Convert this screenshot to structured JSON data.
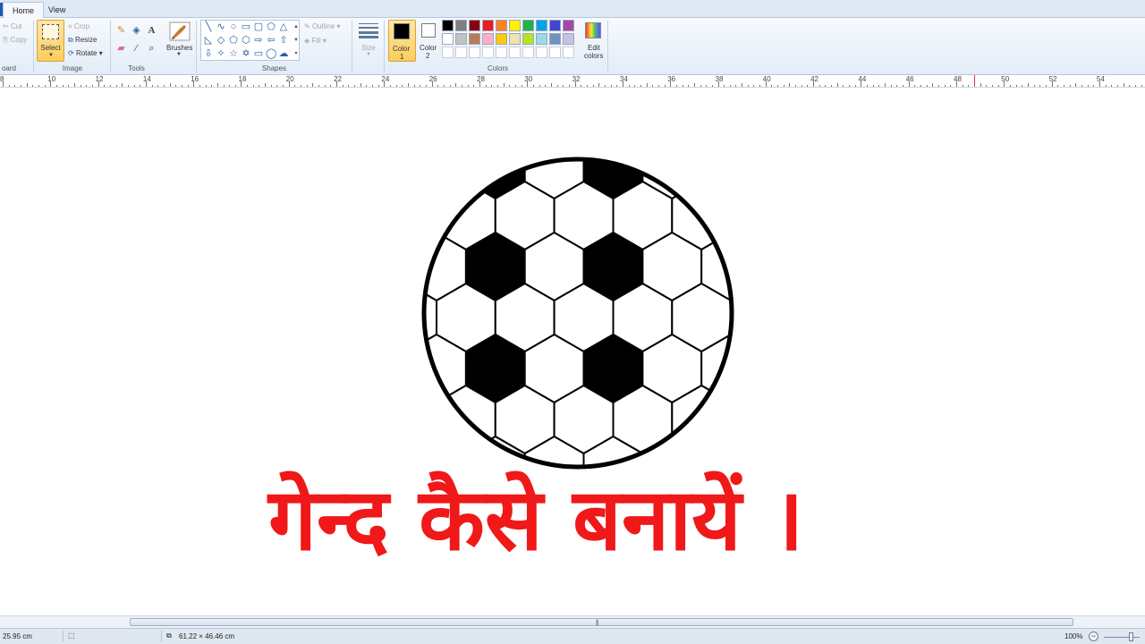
{
  "tabs": {
    "home": "Home",
    "view": "View"
  },
  "clipboard": {
    "cut": "Cut",
    "copy": "Copy",
    "group": "oard"
  },
  "image": {
    "select": "Select",
    "crop": "Crop",
    "resize": "Resize",
    "rotate": "Rotate",
    "group": "Image"
  },
  "tools": {
    "group": "Tools",
    "text_tool": "A"
  },
  "brushes": {
    "label": "Brushes"
  },
  "shapes": {
    "outline": "Outline",
    "fill": "Fill",
    "group": "Shapes"
  },
  "size": {
    "label": "Size"
  },
  "colors": {
    "color1_label": "Color",
    "color1_num": "1",
    "color2_label": "Color",
    "color2_num": "2",
    "edit_label": "Edit",
    "edit_label2": "colors",
    "group": "Colors",
    "color1_value": "#000000",
    "color2_value": "#ffffff",
    "palette_row1": [
      "#000000",
      "#7f7f7f",
      "#880015",
      "#ed1c24",
      "#ff7f27",
      "#fff200",
      "#22b14c",
      "#00a2e8",
      "#3f48cc",
      "#a349a4"
    ],
    "palette_row2": [
      "#ffffff",
      "#c3c3c3",
      "#b97a57",
      "#ffaec9",
      "#ffc90e",
      "#efe4b0",
      "#b5e61d",
      "#99d9ea",
      "#7092be",
      "#c8bfe7"
    ],
    "palette_row3": [
      "#ffffff",
      "#ffffff",
      "#ffffff",
      "#ffffff",
      "#ffffff",
      "#ffffff",
      "#ffffff",
      "#ffffff",
      "#ffffff",
      "#ffffff"
    ]
  },
  "ruler": {
    "labels": [
      "8",
      "10",
      "12",
      "14",
      "16",
      "18",
      "20",
      "22",
      "24",
      "26",
      "28",
      "30",
      "32",
      "34",
      "36",
      "38",
      "40",
      "42",
      "44",
      "46",
      "48",
      "50",
      "52",
      "54"
    ]
  },
  "canvas": {
    "title": "गेन्द कैसे बनायें ।",
    "title_color": "#f01818"
  },
  "status": {
    "position": "25.95 cm",
    "size": "61.22 × 46.46 cm",
    "zoom": "100%"
  }
}
